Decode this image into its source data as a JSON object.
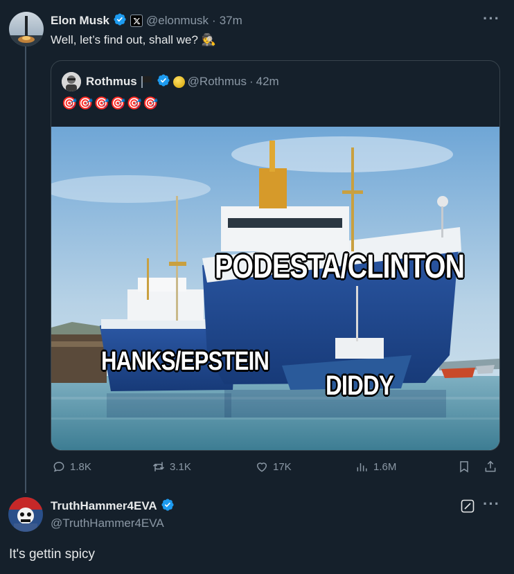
{
  "colors": {
    "background": "#15202b",
    "text": "#e7e9ea",
    "muted": "#8b98a5",
    "verified": "#1d9bf0",
    "border": "#38444d"
  },
  "main_tweet": {
    "display_name": "Elon Musk",
    "handle": "@elonmusk",
    "separator": "·",
    "time": "37m",
    "text": "Well, let’s find out, shall we? 🕵️",
    "more_icon": "more-dots-icon"
  },
  "quoted_tweet": {
    "display_name": "Rothmus",
    "flag": "🏴",
    "handle": "@Rothmus",
    "separator": "·",
    "time": "42m",
    "text": "🎯🎯🎯🎯🎯🎯",
    "meme": {
      "label_big_ship": "PODESTA/CLINTON",
      "label_mid_ship": "HANKS/EPSTEIN",
      "label_small_boat": "DIDDY"
    }
  },
  "actions": {
    "replies": "1.8K",
    "reposts": "3.1K",
    "likes": "17K",
    "views": "1.6M"
  },
  "reply": {
    "display_name": "TruthHammer4EVA",
    "handle": "@TruthHammer4EVA",
    "text": "It's gettin spicy"
  }
}
